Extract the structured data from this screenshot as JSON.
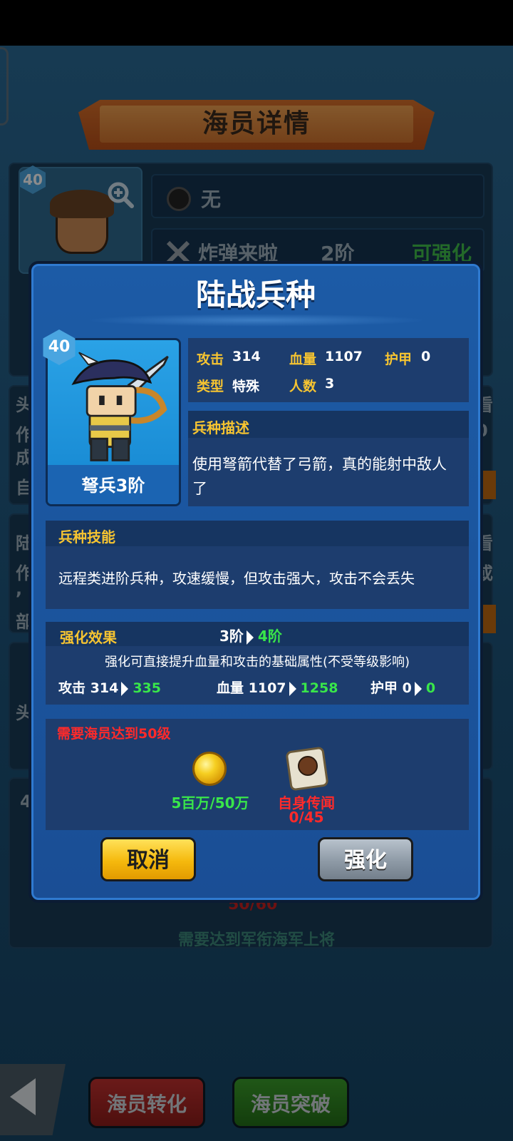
{
  "background": {
    "header_title": "海员详情",
    "level": "40",
    "rows": [
      {
        "icon": "bomb-icon",
        "text": "无"
      },
      {
        "icon": "sword-icon",
        "name": "炸弹来啦",
        "stage": "2阶",
        "status": "可强化"
      }
    ],
    "partial_text": {
      "left_col": [
        "头",
        "作",
        "成",
        "自",
        "陆",
        "作",
        ",",
        "部",
        "头",
        "4"
      ],
      "right_col": [
        "看",
        "0",
        "看",
        "或"
      ],
      "progress": "50/60",
      "requirement": "需要达到军衔海军上将"
    },
    "bottom_buttons": {
      "transform": "海员转化",
      "breakthrough": "海员突破"
    }
  },
  "modal": {
    "title": "陆战兵种",
    "unit": {
      "level": "40",
      "name": "弩兵3阶"
    },
    "stats": {
      "attack_label": "攻击",
      "attack": "314",
      "hp_label": "血量",
      "hp": "1107",
      "armor_label": "护甲",
      "armor": "0",
      "type_label": "类型",
      "type": "特殊",
      "count_label": "人数",
      "count": "3"
    },
    "description": {
      "header": "兵种描述",
      "text": "使用弩箭代替了弓箭，真的能射中敌人了"
    },
    "skill": {
      "header": "兵种技能",
      "text": "远程类进阶兵种，攻速缓慢，但攻击强大，攻击不会丢失"
    },
    "upgrade": {
      "header": "强化效果",
      "from_stage": "3阶",
      "to_stage": "4阶",
      "note": "强化可直接提升血量和攻击的基础属性(不受等级影响)",
      "attack_label": "攻击",
      "attack_from": "314",
      "attack_to": "335",
      "hp_label": "血量",
      "hp_from": "1107",
      "hp_to": "1258",
      "armor_label": "护甲",
      "armor_from": "0",
      "armor_to": "0"
    },
    "requirement": {
      "text": "需要海员达到50级",
      "items": [
        {
          "icon": "gold-coin-icon",
          "label": "5百万/50万"
        },
        {
          "icon": "rumor-puzzle-icon",
          "label": "自身传闻",
          "count": "0/45"
        }
      ]
    },
    "buttons": {
      "cancel": "取消",
      "upgrade": "强化"
    }
  }
}
